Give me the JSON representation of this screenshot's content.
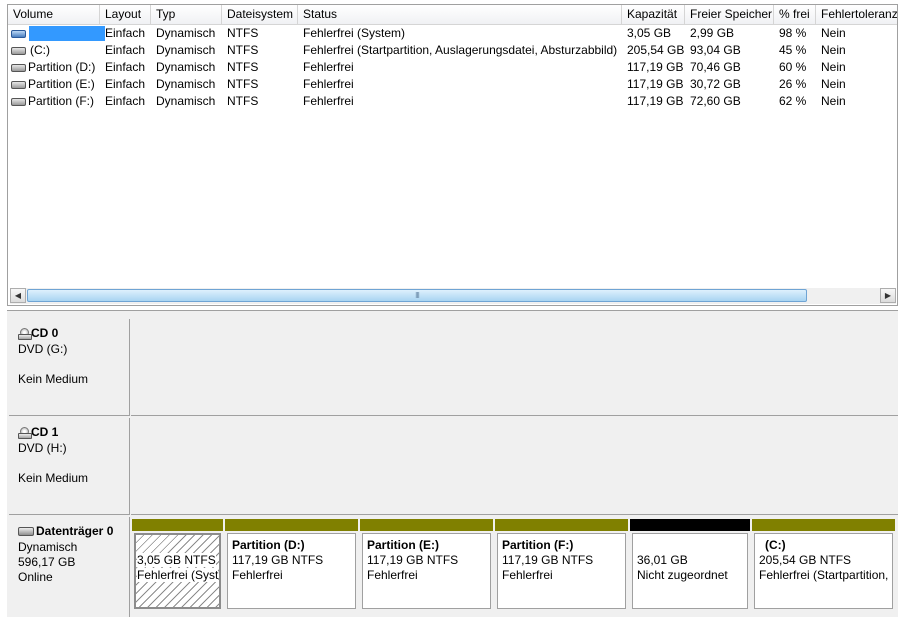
{
  "volume_list": {
    "columns": [
      "Volume",
      "Layout",
      "Typ",
      "Dateisystem",
      "Status",
      "Kapazität",
      "Freier Speicher",
      "% frei",
      "Fehlertoleranz"
    ],
    "rows": [
      {
        "volume": "",
        "layout": "Einfach",
        "typ": "Dynamisch",
        "dateisystem": "NTFS",
        "status": "Fehlerfrei (System)",
        "kapazitaet": "3,05 GB",
        "frei": "2,99 GB",
        "prozent": "98 %",
        "fehlertoleranz": "Nein",
        "icon": "drive-icon-blue",
        "selected": true
      },
      {
        "volume": "(C:)",
        "layout": "Einfach",
        "typ": "Dynamisch",
        "dateisystem": "NTFS",
        "status": "Fehlerfrei (Startpartition, Auslagerungsdatei, Absturzabbild)",
        "kapazitaet": "205,54 GB",
        "frei": "93,04 GB",
        "prozent": "45 %",
        "fehlertoleranz": "Nein",
        "icon": "drive-icon",
        "selected": false
      },
      {
        "volume": "Partition (D:)",
        "layout": "Einfach",
        "typ": "Dynamisch",
        "dateisystem": "NTFS",
        "status": "Fehlerfrei",
        "kapazitaet": "117,19 GB",
        "frei": "70,46 GB",
        "prozent": "60 %",
        "fehlertoleranz": "Nein",
        "icon": "drive-icon",
        "selected": false
      },
      {
        "volume": "Partition (E:)",
        "layout": "Einfach",
        "typ": "Dynamisch",
        "dateisystem": "NTFS",
        "status": "Fehlerfrei",
        "kapazitaet": "117,19 GB",
        "frei": "30,72 GB",
        "prozent": "26 %",
        "fehlertoleranz": "Nein",
        "icon": "drive-icon",
        "selected": false
      },
      {
        "volume": "Partition (F:)",
        "layout": "Einfach",
        "typ": "Dynamisch",
        "dateisystem": "NTFS",
        "status": "Fehlerfrei",
        "kapazitaet": "117,19 GB",
        "frei": "72,60 GB",
        "prozent": "62 %",
        "fehlertoleranz": "Nein",
        "icon": "drive-icon",
        "selected": false
      }
    ],
    "scrollbar": {
      "thumb_grip": "III"
    }
  },
  "disks": {
    "cd0": {
      "title": "CD 0",
      "drive": "DVD (G:)",
      "status": "Kein Medium",
      "icon": "cd-drive-icon"
    },
    "cd1": {
      "title": "CD 1",
      "drive": "DVD (H:)",
      "status": "Kein Medium",
      "icon": "cd-drive-icon"
    },
    "disk0": {
      "title": "Datenträger 0",
      "type": "Dynamisch",
      "size": "596,17 GB",
      "state": "Online",
      "icon": "hard-disk-icon",
      "partitions": [
        {
          "name": "",
          "size": "3,05 GB NTFS",
          "status": "Fehlerfrei (Syst",
          "bar_color": "#808000",
          "selected": true
        },
        {
          "name": "Partition  (D:)",
          "size": "117,19 GB NTFS",
          "status": "Fehlerfrei",
          "bar_color": "#808000",
          "selected": false
        },
        {
          "name": "Partition  (E:)",
          "size": "117,19 GB NTFS",
          "status": "Fehlerfrei",
          "bar_color": "#808000",
          "selected": false
        },
        {
          "name": "Partition  (F:)",
          "size": "117,19 GB NTFS",
          "status": "Fehlerfrei",
          "bar_color": "#808000",
          "selected": false
        },
        {
          "name": "",
          "size": "36,01 GB",
          "status": "Nicht zugeordnet",
          "bar_color": "#000000",
          "selected": false
        },
        {
          "name": "(C:)",
          "size": "205,54 GB NTFS",
          "status": "Fehlerfrei (Startpartition,",
          "bar_color": "#808000",
          "selected": false
        }
      ]
    }
  }
}
